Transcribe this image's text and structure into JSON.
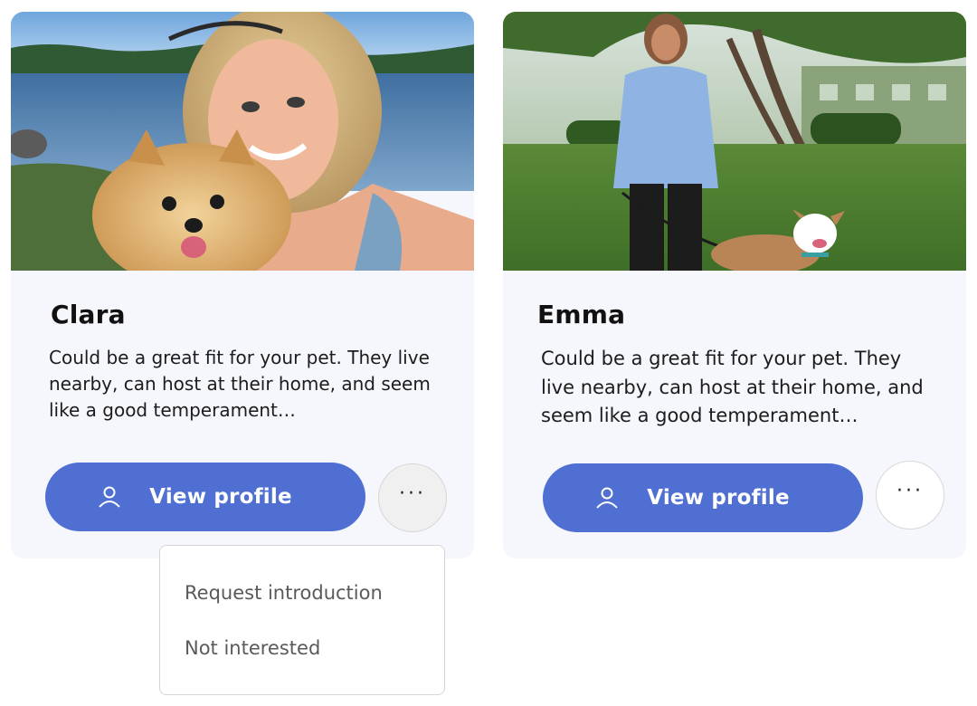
{
  "cards": [
    {
      "name": "Clara",
      "description": "Could be a great fit for your pet. They live nearby, can host at their home, and seem like a good temperament…",
      "view_profile_label": "View profile",
      "more_label": "···",
      "photo": "Woman taking a selfie with a Pomeranian dog by a lake"
    },
    {
      "name": "Emma",
      "description": "Could be a great fit for your pet. They live nearby, can host at their home, and seem like a good temperament…",
      "view_profile_label": "View profile",
      "more_label": "···",
      "photo": "Woman in a blue jacket standing in a park with a dog on a leash"
    }
  ],
  "dropdown": {
    "items": [
      {
        "label": "Request introduction"
      },
      {
        "label": "Not interested"
      }
    ]
  },
  "colors": {
    "primary_button": "#4f6fd3",
    "card_background": "#f6f7fc",
    "text": "#1c1c1c",
    "menu_text": "#5a5a5a"
  },
  "icons": {
    "view_profile": "user-icon",
    "more": "more-horizontal-icon"
  }
}
